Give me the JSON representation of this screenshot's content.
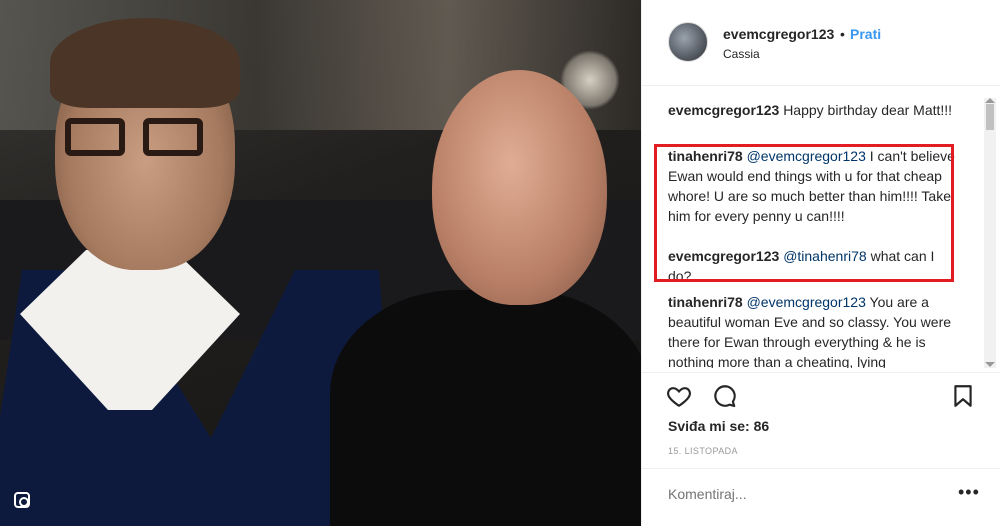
{
  "header": {
    "username": "evemcgregor123",
    "separator": "•",
    "follow_label": "Prati",
    "location": "Cassia"
  },
  "comments": [
    {
      "user": "evemcgregor123",
      "mention": "",
      "text": "Happy birthday dear Matt!!!"
    },
    {
      "user": "tinahenri78",
      "mention": "@evemcgregor123",
      "text": "I can't believe Ewan would end things with u for that cheap whore! U are so much better than him!!!! Take him for every penny u can!!!!"
    },
    {
      "user": "evemcgregor123",
      "mention": "@tinahenri78",
      "text": "what can I do?"
    },
    {
      "user": "tinahenri78",
      "mention": "@evemcgregor123",
      "text": "You are a beautiful woman Eve and so classy. You were there for Ewan through everything & he is nothing more than a cheating, lying"
    }
  ],
  "stats": {
    "likes": "Sviđa mi se: 86",
    "date": "15. LISTOPADA"
  },
  "comment_box": {
    "placeholder": "Komentiraj...",
    "more": "•••"
  },
  "icons": [
    "heart-icon",
    "comment-icon",
    "bookmark-icon",
    "instagram-multi-icon"
  ],
  "colors": {
    "accent": "#3897f0",
    "highlight_box": "#e31b23",
    "text": "#262626"
  }
}
